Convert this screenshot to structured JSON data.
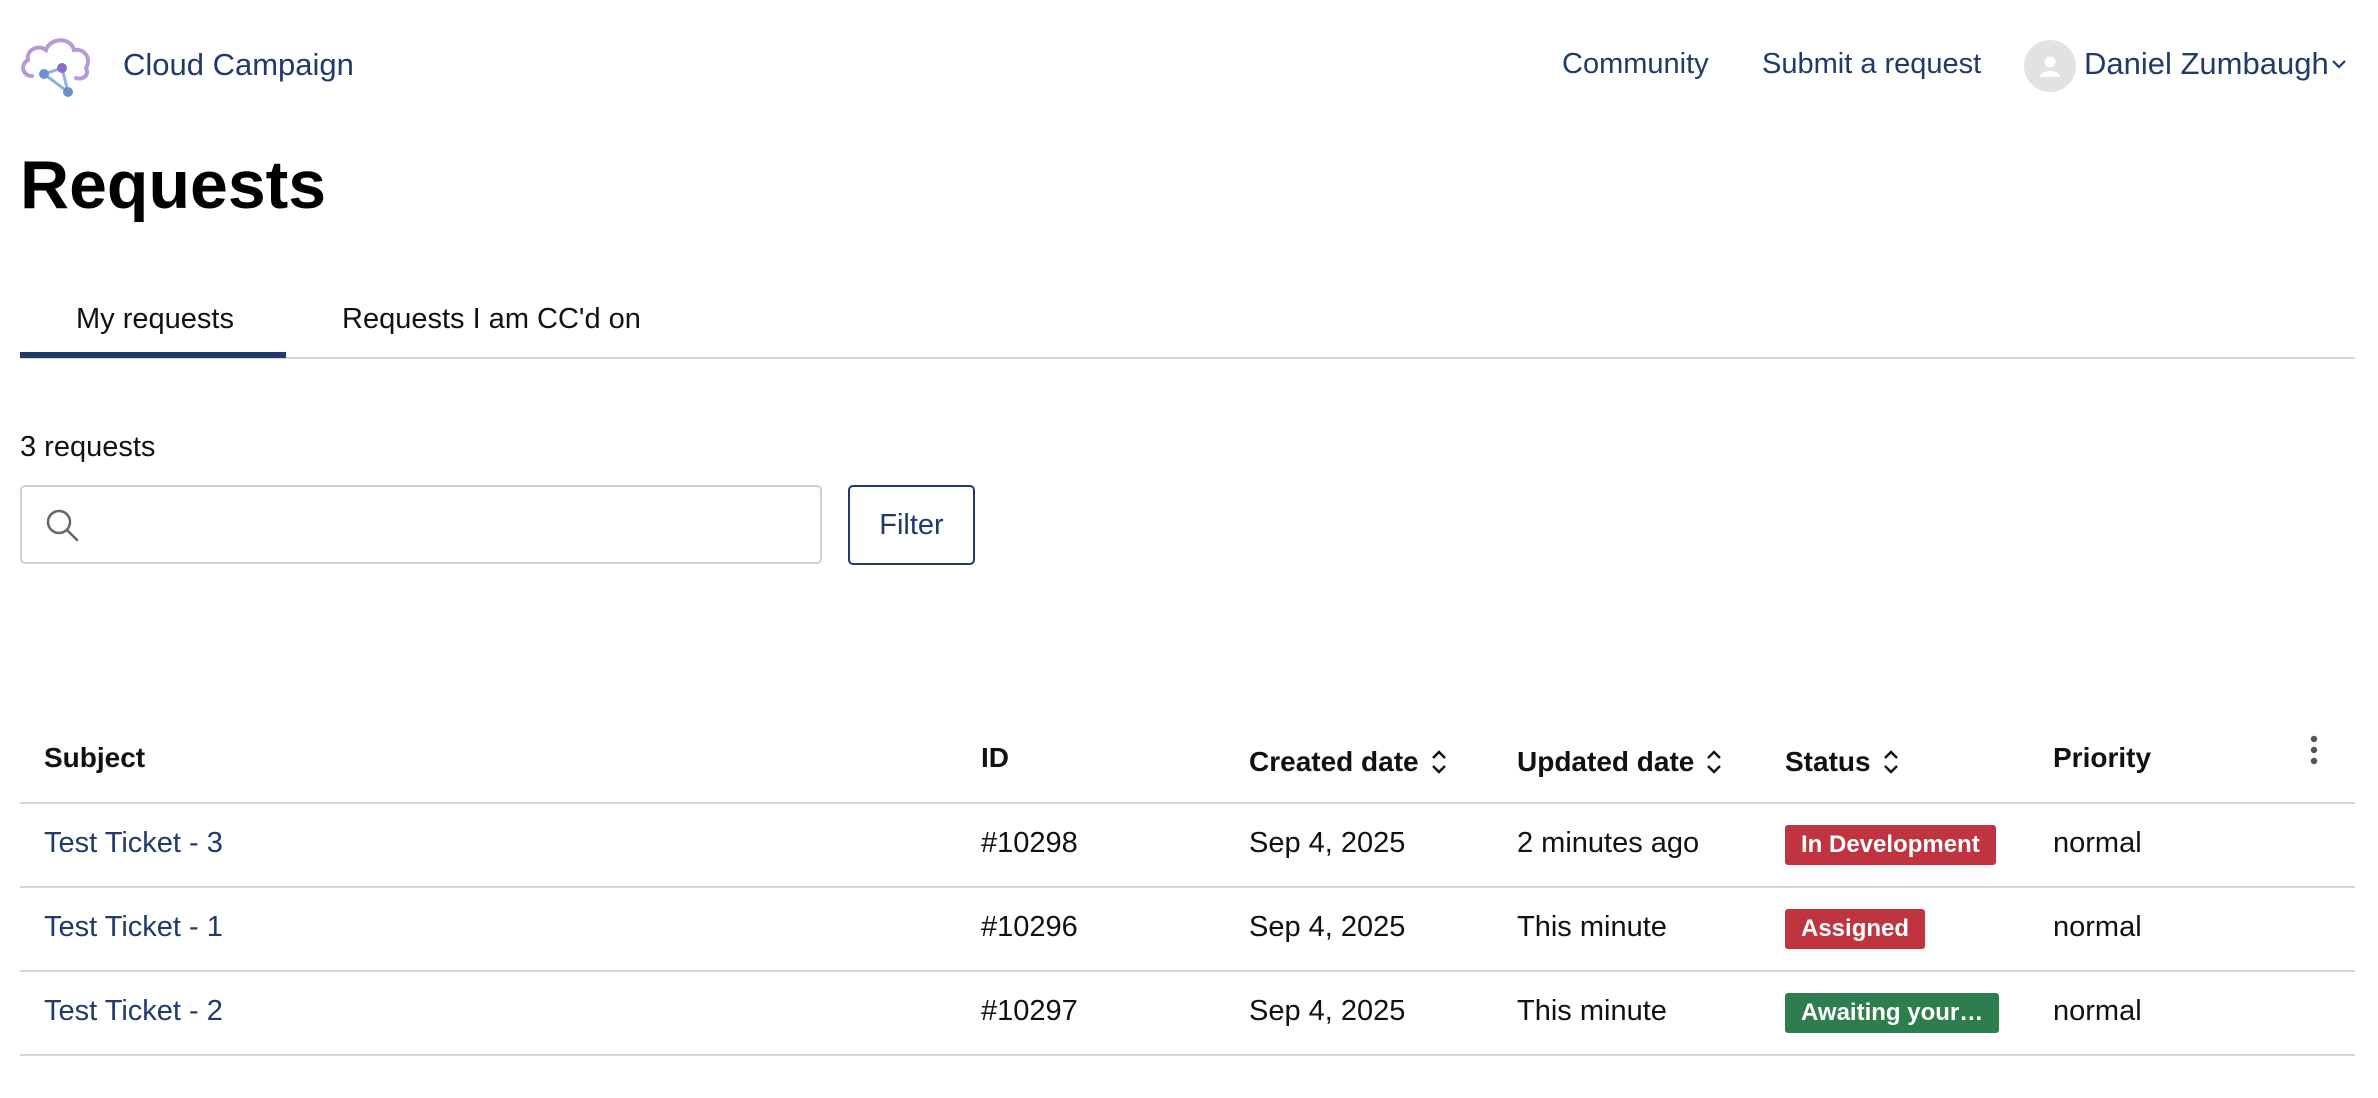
{
  "header": {
    "brand": "Cloud Campaign",
    "nav": {
      "community": "Community",
      "submit_request": "Submit a request"
    },
    "user": {
      "name": "Daniel Zumbaugh"
    }
  },
  "page_title": "Requests",
  "tabs": [
    {
      "label": "My requests",
      "active": true
    },
    {
      "label": "Requests I am CC'd on",
      "active": false
    }
  ],
  "request_count": "3 requests",
  "search": {
    "value": "",
    "placeholder": ""
  },
  "filter_label": "Filter",
  "table": {
    "headers": {
      "subject": "Subject",
      "id": "ID",
      "created": "Created date",
      "updated": "Updated date",
      "status": "Status",
      "priority": "Priority"
    },
    "rows": [
      {
        "subject": "Test Ticket - 3",
        "id": "#10298",
        "created": "Sep 4, 2025",
        "updated": "2 minutes ago",
        "status": "In Development",
        "status_color": "#c0343f",
        "priority": "normal"
      },
      {
        "subject": "Test Ticket - 1",
        "id": "#10296",
        "created": "Sep 4, 2025",
        "updated": "This minute",
        "status": "Assigned",
        "status_color": "#c0343f",
        "priority": "normal"
      },
      {
        "subject": "Test Ticket - 2",
        "id": "#10297",
        "created": "Sep 4, 2025",
        "updated": "This minute",
        "status": "Awaiting your…",
        "status_color": "#2e7d4f",
        "priority": "normal"
      }
    ]
  },
  "colors": {
    "primary": "#1f3a6b",
    "divider": "#d6d6d6",
    "badge_red": "#c0343f",
    "badge_green": "#2e7d4f"
  }
}
